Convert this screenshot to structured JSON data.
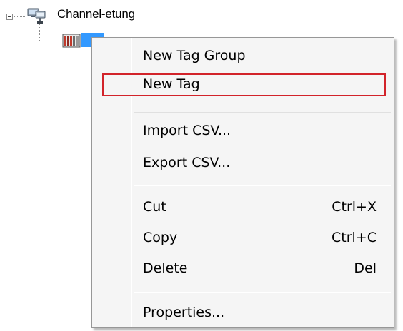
{
  "tree": {
    "root_label": "Channel-etung",
    "device_label": ""
  },
  "context_menu": {
    "groups": [
      [
        {
          "label": "New Tag Group",
          "shortcut": ""
        },
        {
          "label": "New Tag",
          "shortcut": "",
          "highlighted": true
        }
      ],
      [
        {
          "label": "Import CSV...",
          "shortcut": ""
        },
        {
          "label": "Export CSV...",
          "shortcut": ""
        }
      ],
      [
        {
          "label": "Cut",
          "shortcut": "Ctrl+X"
        },
        {
          "label": "Copy",
          "shortcut": "Ctrl+C"
        },
        {
          "label": "Delete",
          "shortcut": "Del"
        }
      ],
      [
        {
          "label": "Properties...",
          "shortcut": ""
        }
      ]
    ]
  },
  "colors": {
    "menu_background": "#f5f5f5",
    "menu_border": "#979797",
    "selection_blue": "#3399ff",
    "annotation_red": "#d2232a"
  },
  "icons": {
    "expander": "collapse-minus-icon",
    "channel": "network-channel-icon",
    "device": "device-plc-icon"
  }
}
